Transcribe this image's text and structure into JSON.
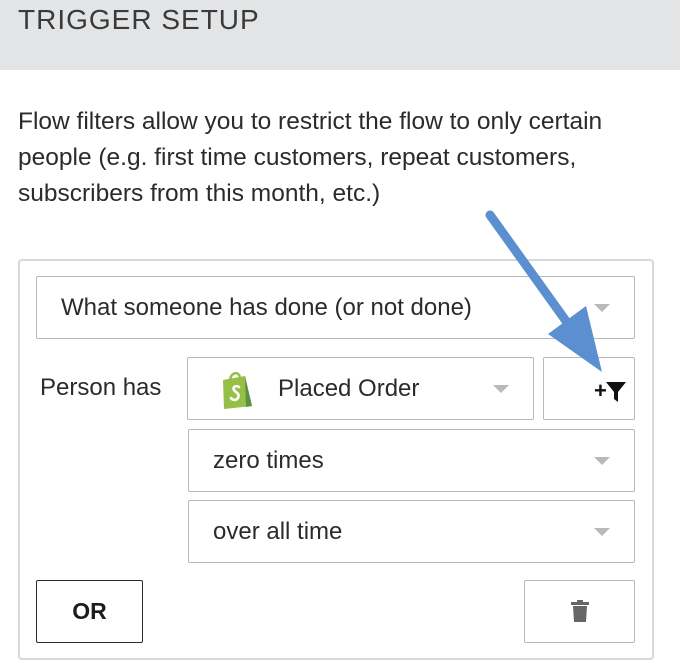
{
  "header": {
    "title": "TRIGGER SETUP"
  },
  "description": "Flow filters allow you to restrict the flow to only certain people (e.g. first time customers, repeat customers, subscribers from this month, etc.)",
  "filter": {
    "condition_type": "What someone has done (or not done)",
    "person_has_label": "Person has",
    "event": "Placed Order",
    "event_icon": "shopify-bag-icon",
    "add_filter_plus": "+",
    "frequency": "zero times",
    "timeframe": "over all time",
    "or_label": "OR"
  },
  "colors": {
    "header_bg": "#e3e4e6",
    "shopify_green": "#95bf47",
    "arrow_blue": "#5b8fcf"
  }
}
